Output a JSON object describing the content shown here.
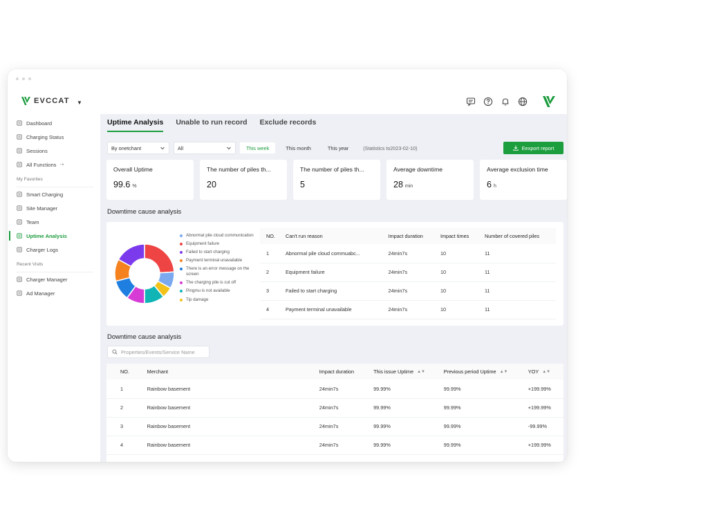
{
  "app": {
    "logo_text": "EVCCAT"
  },
  "sidebar": {
    "items": [
      {
        "label": "Dashboard",
        "icon": "dashboard-icon"
      },
      {
        "label": "Charging Status",
        "icon": "charging-status-icon"
      },
      {
        "label": "Sessions",
        "icon": "sessions-icon"
      },
      {
        "label": "All Functions",
        "icon": "grid-icon"
      }
    ],
    "favorites_title": "My Favorites",
    "favorites": [
      {
        "label": "Smart Charging",
        "icon": "smart-charging-icon"
      },
      {
        "label": "Site Manager",
        "icon": "site-manager-icon"
      },
      {
        "label": "Team",
        "icon": "team-icon"
      },
      {
        "label": "Uptime Analysis",
        "icon": "uptime-icon",
        "active": true
      },
      {
        "label": "Charger Logs",
        "icon": "logs-icon"
      }
    ],
    "recent_title": "Recent Visits",
    "recent": [
      {
        "label": "Charger Manager",
        "icon": "charger-manager-icon"
      },
      {
        "label": "Ad Manager",
        "icon": "ad-manager-icon"
      }
    ]
  },
  "tabs": [
    "Uptime Analysis",
    "Unable to run record",
    "Exclude records"
  ],
  "filters": {
    "merchant_select": "By onetchant",
    "scope_select": "All",
    "periods": [
      "This week",
      "This month",
      "This year"
    ],
    "statistics_note": "(Statistics to2023-02-10)",
    "export_label": "Eexport report"
  },
  "cards": [
    {
      "label": "Overall Uptime",
      "value": "99.6",
      "unit": "%"
    },
    {
      "label": "The number of piles th...",
      "value": "20",
      "unit": ""
    },
    {
      "label": "The number of piles th...",
      "value": "5",
      "unit": ""
    },
    {
      "label": "Average downtime",
      "value": "28",
      "unit": "min"
    },
    {
      "label": "Average exclusion time",
      "value": "6",
      "unit": "h"
    }
  ],
  "cause_section": {
    "title": "Downtime cause analysis",
    "legend": [
      {
        "label": "Abnormal pile cloud communication",
        "color": "#7aa9f0"
      },
      {
        "label": "Equipment failure",
        "color": "#ef4444"
      },
      {
        "label": "Failed to start charging",
        "color": "#7c3aed"
      },
      {
        "label": "Payment terminal unavailable",
        "color": "#f5811f"
      },
      {
        "label": "There is an error message on the screen",
        "color": "#1f7fe0"
      },
      {
        "label": "The charging pile is cut off",
        "color": "#d63bd6"
      },
      {
        "label": "Pingmu is not available",
        "color": "#11b5b5"
      },
      {
        "label": "Tip damage",
        "color": "#f2c21a"
      }
    ],
    "donut": [
      {
        "value": 24,
        "color": "#ef4444"
      },
      {
        "value": 9,
        "color": "#7aa9f0"
      },
      {
        "value": 6,
        "color": "#f2c21a"
      },
      {
        "value": 11,
        "color": "#11b5b5"
      },
      {
        "value": 10,
        "color": "#d63bd6"
      },
      {
        "value": 11,
        "color": "#1f7fe0"
      },
      {
        "value": 12,
        "color": "#f5811f"
      },
      {
        "value": 17,
        "color": "#7c3aed"
      }
    ],
    "headers": [
      "NO.",
      "Can't run reason",
      "Impact duration",
      "Impact times",
      "Number of covered piles"
    ],
    "rows": [
      [
        "1",
        "Abnormal pile cloud commuabc...",
        "24min7s",
        "10",
        "11"
      ],
      [
        "2",
        "Equipment failure",
        "24min7s",
        "10",
        "11"
      ],
      [
        "3",
        "Failed to start charging",
        "24min7s",
        "10",
        "11"
      ],
      [
        "4",
        "Payment terminal unavailable",
        "24min7s",
        "10",
        "11"
      ]
    ]
  },
  "merchant_section": {
    "title": "Downtime cause analysis",
    "search_placeholder": "Properties/Events/Service Name",
    "headers": [
      "NO.",
      "Merchant",
      "Impact duration",
      "This issue Uptime",
      "Previous period Uptime",
      "YOY"
    ],
    "rows": [
      {
        "no": "1",
        "merchant": "Rainbow basement",
        "duration": "24min7s",
        "uptime": "99.99%",
        "uptime_status": "normal",
        "prev": "99.99%",
        "yoy": "+199.99%",
        "yoy_status": "pos"
      },
      {
        "no": "2",
        "merchant": "Rainbow basement",
        "duration": "24min7s",
        "uptime": "99.99%",
        "uptime_status": "normal",
        "prev": "99.99%",
        "yoy": "+199.99%",
        "yoy_status": "pos"
      },
      {
        "no": "3",
        "merchant": "Rainbow basement",
        "duration": "24min7s",
        "uptime": "99.99%",
        "uptime_status": "neg",
        "prev": "99.99%",
        "yoy": "-99.99%",
        "yoy_status": "neg"
      },
      {
        "no": "4",
        "merchant": "Rainbow basement",
        "duration": "24min7s",
        "uptime": "99.99%",
        "uptime_status": "normal",
        "prev": "99.99%",
        "yoy": "+199.99%",
        "yoy_status": "pos"
      }
    ]
  }
}
